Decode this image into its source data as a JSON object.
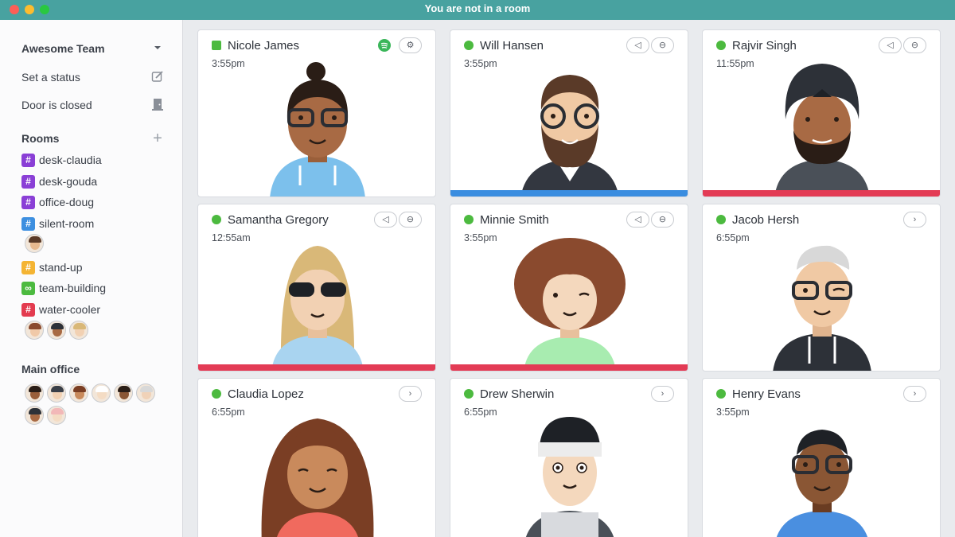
{
  "window": {
    "title": "You are not in a room"
  },
  "sidebar": {
    "team": "Awesome Team",
    "set_status": "Set a status",
    "door": "Door is closed",
    "rooms_heading": "Rooms",
    "rooms": [
      {
        "label": "desk-claudia",
        "color": "#8a3fd6",
        "glyph": "#"
      },
      {
        "label": "desk-gouda",
        "color": "#8a3fd6",
        "glyph": "#"
      },
      {
        "label": "office-doug",
        "color": "#8a3fd6",
        "glyph": "#"
      },
      {
        "label": "silent-room",
        "color": "#3d8fe0",
        "glyph": "#"
      },
      {
        "label": "stand-up",
        "color": "#f4b433",
        "glyph": "#"
      },
      {
        "label": "team-building",
        "color": "#4cba3f",
        "glyph": "∞"
      },
      {
        "label": "water-cooler",
        "color": "#e33b4f",
        "glyph": "#"
      }
    ],
    "main_office_heading": "Main office"
  },
  "people": [
    {
      "name": "Nicole James",
      "time": "3:55pm",
      "status": "square",
      "bar": ""
    },
    {
      "name": "Will Hansen",
      "time": "3:55pm",
      "status": "dot",
      "bar": "#3a8de0"
    },
    {
      "name": "Rajvir Singh",
      "time": "11:55pm",
      "status": "dot",
      "bar": "#e33b55"
    },
    {
      "name": "Samantha Gregory",
      "time": "12:55am",
      "status": "dot",
      "bar": "#e33b55"
    },
    {
      "name": "Minnie Smith",
      "time": "3:55pm",
      "status": "dot",
      "bar": "#e33b55"
    },
    {
      "name": "Jacob Hersh",
      "time": "6:55pm",
      "status": "dot",
      "bar": ""
    },
    {
      "name": "Claudia Lopez",
      "time": "6:55pm",
      "status": "dot",
      "bar": ""
    },
    {
      "name": "Drew Sherwin",
      "time": "6:55pm",
      "status": "dot",
      "bar": ""
    },
    {
      "name": "Henry Evans",
      "time": "3:55pm",
      "status": "dot",
      "bar": ""
    }
  ],
  "colors": {
    "online": "#4cba3f",
    "titlebar": "#48a2a0",
    "spotify": "#3bb65a"
  }
}
